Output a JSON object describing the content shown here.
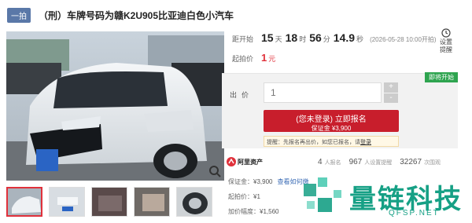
{
  "header": {
    "tag": "一拍",
    "title": "（刑）车牌号码为赣K2U905比亚迪白色小汽车"
  },
  "countdown": {
    "label": "距开始",
    "days": "15",
    "days_unit": "天",
    "hours": "18",
    "hours_unit": "时",
    "minutes": "56",
    "minutes_unit": "分",
    "seconds": "14.9",
    "seconds_unit": "秒",
    "start_time": "(2026-05-28 10:00开拍)"
  },
  "start_price": {
    "label": "起拍价",
    "value": "1",
    "unit": "元"
  },
  "remind": {
    "label": "设置提醒"
  },
  "bid": {
    "badge": "即将开始",
    "out_label": "出价",
    "input_placeholder": "1",
    "plus": "+",
    "minus": "-",
    "register_main": "(您未登录) 立即报名",
    "register_sub": "保证金 ¥3,900",
    "hint_text": "提醒：先报名再出价，如您已报名，请",
    "hint_link": "登录"
  },
  "stats": {
    "platform": "阿里资产",
    "signups": "4",
    "signups_label": "人报名",
    "reminders": "967",
    "reminders_label": "人设置提醒",
    "views": "32267",
    "views_label": "次围观"
  },
  "info": {
    "deposit_label": "保证金：",
    "deposit_value": "¥3,900",
    "deposit_link": "查看如何缴",
    "start_label": "起拍价：",
    "start_value": "¥1",
    "increment_label": "加价幅度：",
    "increment_value": "¥1,560"
  },
  "watermark": {
    "cn": "量链科技",
    "en": "QFSP.NET"
  },
  "colors": {
    "accent_red": "#c81e2c",
    "price_red": "#e0313b",
    "green": "#2ea44f",
    "watermark": "#16a085"
  }
}
